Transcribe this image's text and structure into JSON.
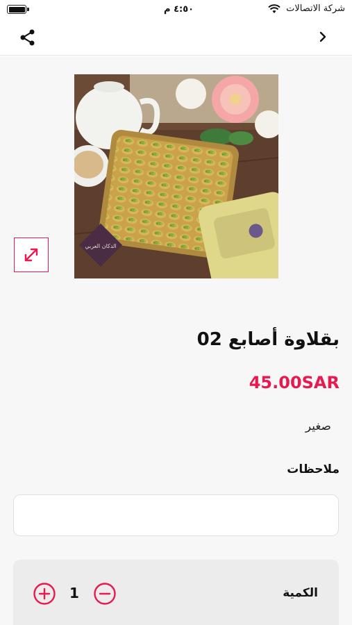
{
  "status_bar": {
    "time": "٤:٥٠ م",
    "carrier": "شركة الاتصالات"
  },
  "header": {
    "share_icon": "share-icon",
    "back_icon": "chevron-right-icon"
  },
  "product": {
    "title": "بقلاوة أصابع  02",
    "price": "45.00SAR",
    "size": "صغير",
    "image_logo_text": "الدكان العربي"
  },
  "notes": {
    "label": "ملاحظات",
    "value": "",
    "placeholder": ""
  },
  "quantity": {
    "label": "الكمية",
    "value": "1"
  },
  "colors": {
    "accent": "#e8194f",
    "background": "#f7f7f7"
  }
}
